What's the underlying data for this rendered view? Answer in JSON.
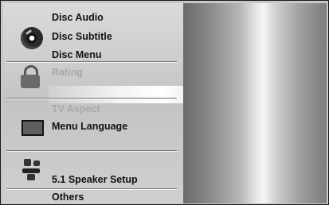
{
  "menu": {
    "items": [
      {
        "label": "Disc Audio",
        "state": "normal"
      },
      {
        "label": "Disc Subtitle",
        "state": "normal"
      },
      {
        "label": "Disc Menu",
        "state": "normal"
      },
      {
        "label": "Rating",
        "state": "dimmed"
      },
      {
        "label": "TV Aspect",
        "state": "dimmed"
      },
      {
        "label": "Menu Language",
        "state": "normal"
      },
      {
        "label": "5.1 Speaker Setup",
        "state": "normal"
      },
      {
        "label": "Others",
        "state": "normal"
      }
    ],
    "icons": [
      "disc-icon",
      "padlock-icon",
      "monitor-icon",
      "speaker-icon"
    ]
  },
  "colors": {
    "text": "#111111",
    "dimmed_text": "#a8a8a8",
    "panel": "#c8c8c8"
  }
}
